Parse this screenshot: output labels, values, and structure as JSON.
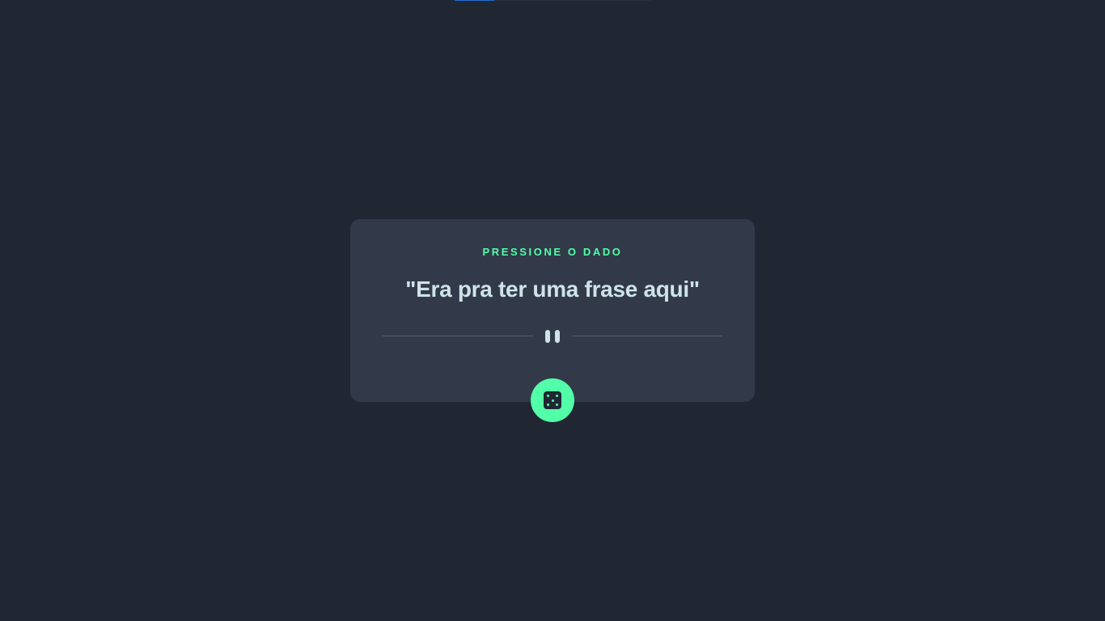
{
  "advice": {
    "label": "PRESSIONE O DADO",
    "quote": "\"Era pra ter uma frase aqui\""
  },
  "icons": {
    "divider": "pause-icon",
    "button": "dice-icon"
  },
  "colors": {
    "background": "#202632",
    "card": "#323a49",
    "accent": "#52ffa8",
    "text": "#cee3e9",
    "divider": "#4f5d73"
  }
}
